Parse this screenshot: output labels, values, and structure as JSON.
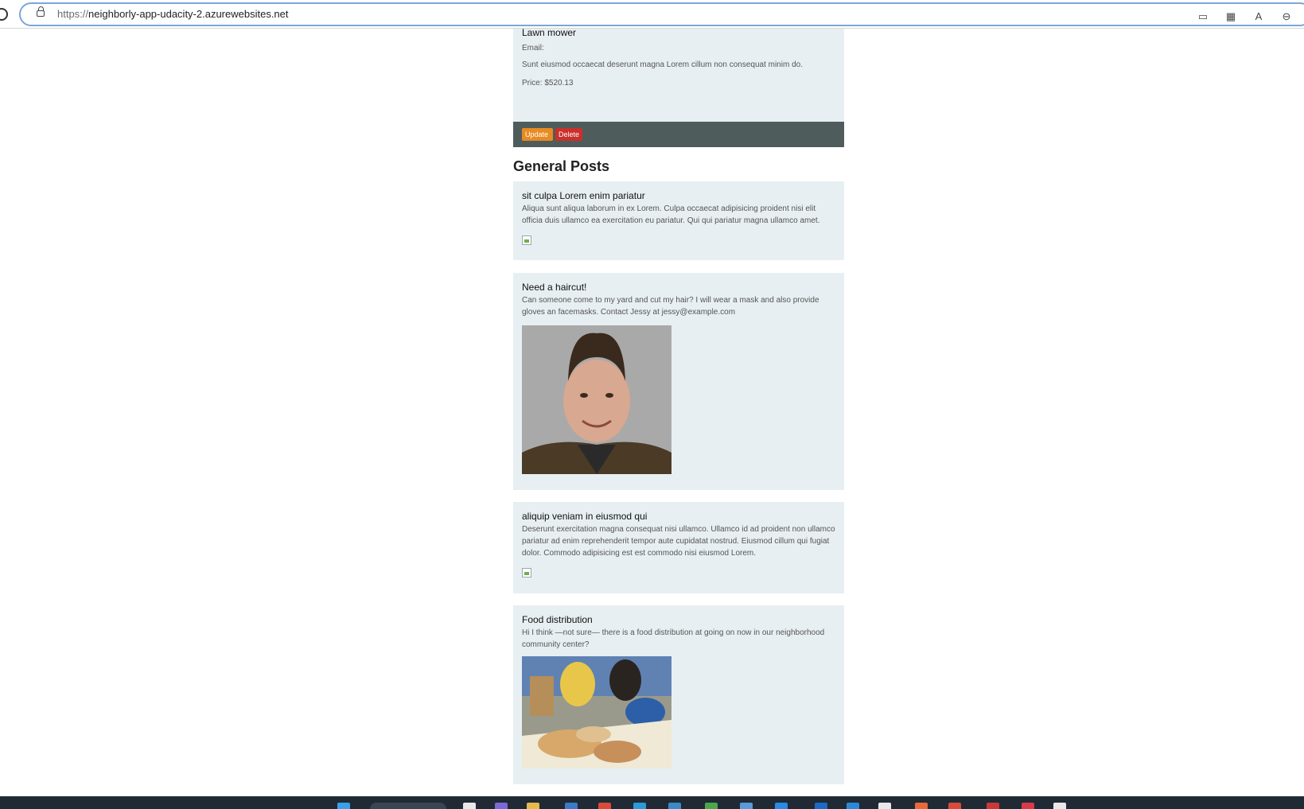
{
  "browser": {
    "url_scheme": "https://",
    "url_host": "neighborly-app-udacity-2.azurewebsites.net",
    "toolbar_icons": [
      "reading-view-icon",
      "apps-icon",
      "read-aloud-icon",
      "zoom-out-icon",
      "add-favorite-icon"
    ]
  },
  "item": {
    "title": "Lawn mower",
    "email_label": "Email:",
    "description": "Sunt eiusmod occaecat deserunt magna Lorem cillum non consequat minim do.",
    "price": "Price: $520.13",
    "update_label": "Update",
    "delete_label": "Delete"
  },
  "general_posts": {
    "heading": "General Posts",
    "posts": [
      {
        "title": "sit culpa Lorem enim pariatur",
        "body": "Aliqua sunt aliqua laborum in ex Lorem. Culpa occaecat adipisicing proident nisi elit officia duis ullamco ea exercitation eu pariatur. Qui qui pariatur magna ullamco amet.",
        "image": "broken-image-icon"
      },
      {
        "title": "Need a haircut!",
        "body": "Can someone come to my yard and cut my hair? I will wear a mask and also provide gloves an facemasks. Contact Jessy at jessy@example.com",
        "image": "portrait-photo"
      },
      {
        "title": "aliquip veniam in eiusmod qui",
        "body": "Deserunt exercitation magna consequat nisi ullamco. Ullamco id ad proident non ullamco pariatur ad enim reprehenderit tempor aute cupidatat nostrud. Eiusmod cillum qui fugiat dolor. Commodo adipisicing est est commodo nisi eiusmod Lorem.",
        "image": "broken-image-icon"
      },
      {
        "title": "Food distribution",
        "body": "Hi I think —not sure— there is a food distribution at going on now in our neighborhood community center?",
        "image": "food-distribution-photo"
      }
    ]
  },
  "colors": {
    "card_background": "#e8eff2",
    "footer_bar": "#4f5c5c",
    "update_button": "#e78b22",
    "delete_button": "#c9302c",
    "taskbar": "#1f2a35"
  }
}
